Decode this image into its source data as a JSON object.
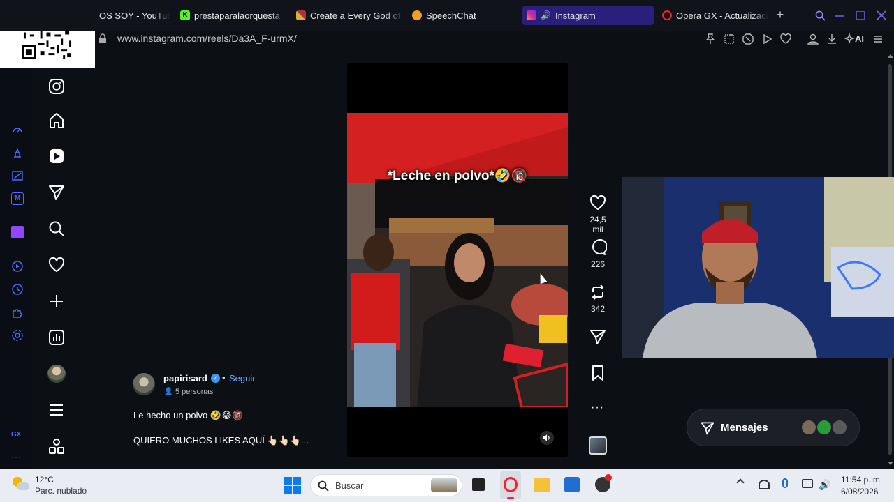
{
  "browser": {
    "tabs": [
      {
        "label": "OS SOY - YouTube",
        "color": "#ff0000"
      },
      {
        "label": "prestaparalaorquesta",
        "color": "#53fc18"
      },
      {
        "label": "Create a Every God of",
        "color": "#d9b03a"
      },
      {
        "label": "SpeechChat",
        "color": "#f0a020"
      },
      {
        "label": "Instagram",
        "color": "#d6249f"
      },
      {
        "label": "Opera GX - Actualizaci",
        "color": "#ff1b2d"
      }
    ],
    "url": "www.instagram.com/reels/Da3A_F-urmX/",
    "ai_label": "AI"
  },
  "sidebar": {
    "gx_label": "GX",
    "more_label": "···"
  },
  "reel": {
    "overlay_text": "*Leche en polvo*🤣🔞",
    "likes": "24,5 mil",
    "comments": "226",
    "reposts": "342",
    "more": "···"
  },
  "author": {
    "username": "papirisard",
    "follow_label": "Seguir",
    "collab": "5 personas",
    "caption_line1": "Le hecho un polvo 🤣😂🔞",
    "caption_line2": "QUIERO MUCHOS LIKES AQUÍ 👆🏻👆🏻👆🏻..."
  },
  "messages": {
    "label": "Mensajes"
  },
  "taskbar": {
    "temp": "12°C",
    "weather": "Parc. nublado",
    "search_placeholder": "Buscar",
    "time": "11:54 p. m.",
    "date": "6/08/2026"
  },
  "colors": {
    "accent": "#5b3cf0",
    "verified": "#3897f0",
    "follow": "#4a9cf5"
  }
}
